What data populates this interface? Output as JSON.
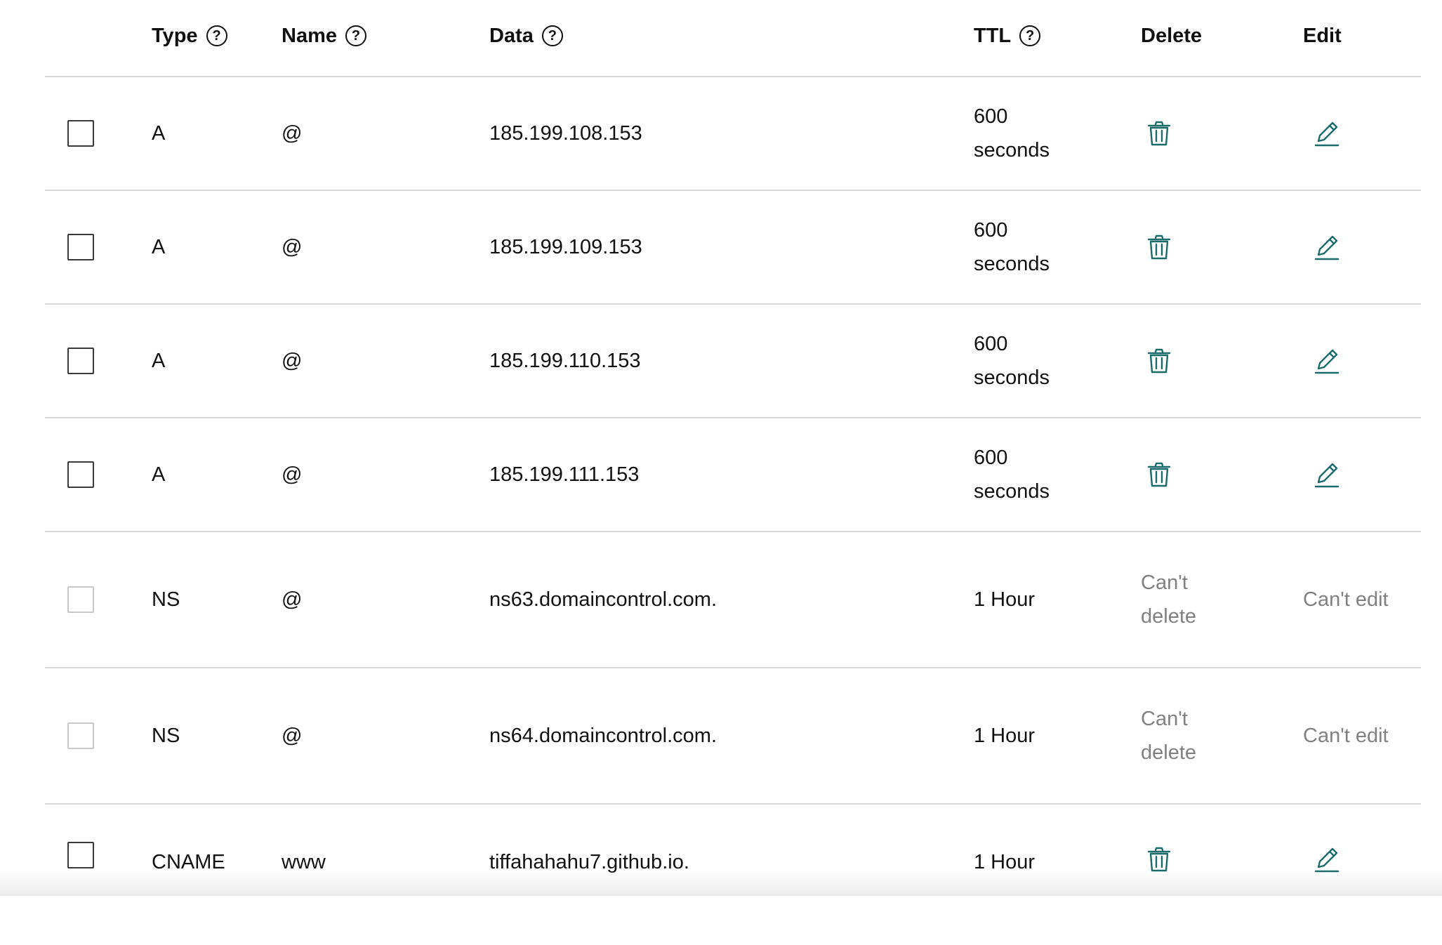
{
  "columns": {
    "type": "Type",
    "name": "Name",
    "data": "Data",
    "ttl": "TTL",
    "delete": "Delete",
    "edit": "Edit"
  },
  "help_glyph": "?",
  "records": [
    {
      "type": "A",
      "name": "@",
      "data": "185.199.108.153",
      "ttl": "600 seconds",
      "editable": true
    },
    {
      "type": "A",
      "name": "@",
      "data": "185.199.109.153",
      "ttl": "600 seconds",
      "editable": true
    },
    {
      "type": "A",
      "name": "@",
      "data": "185.199.110.153",
      "ttl": "600 seconds",
      "editable": true
    },
    {
      "type": "A",
      "name": "@",
      "data": "185.199.111.153",
      "ttl": "600 seconds",
      "editable": true
    },
    {
      "type": "NS",
      "name": "@",
      "data": "ns63.domaincontrol.com.",
      "ttl": "1 Hour",
      "editable": false,
      "delete_text": "Can't delete",
      "edit_text": "Can't edit"
    },
    {
      "type": "NS",
      "name": "@",
      "data": "ns64.domaincontrol.com.",
      "ttl": "1 Hour",
      "editable": false,
      "delete_text": "Can't delete",
      "edit_text": "Can't edit"
    },
    {
      "type": "CNAME",
      "name": "www",
      "data": "tiffahahahu7.github.io.",
      "ttl": "1 Hour",
      "editable": true
    }
  ],
  "icons": {
    "delete": "trash-icon",
    "edit": "pencil-icon",
    "help": "help-circle-icon"
  },
  "colors": {
    "accent": "#1b6b6b",
    "muted_text": "#808080",
    "divider": "#d6d6d6"
  }
}
